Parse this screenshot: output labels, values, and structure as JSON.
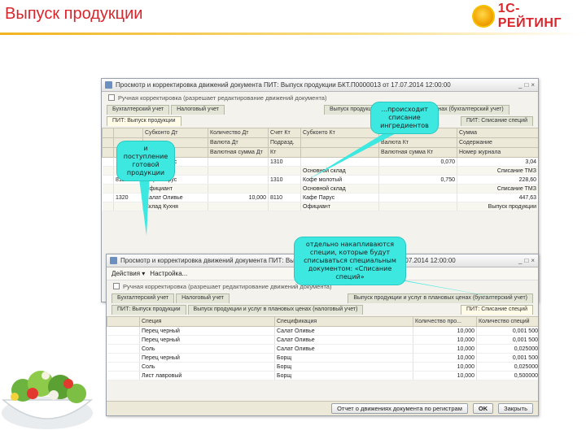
{
  "slide": {
    "title": "Выпуск продукции",
    "logo_text": "1С-РЕЙТИНГ"
  },
  "window1": {
    "title": "Просмотр и корректировка движений документа ПИТ: Выпуск продукции БКТ.П0000013 от 17.07.2014 12:00:00",
    "manual_check_label": "Ручная корректировка (разрешает редактирование движений документа)",
    "tabs": [
      "Бухгалтерский учет",
      "Налоговый учет",
      "ПИТ: Выпуск продукции",
      "Выпуск продукции и услуг в плановых ценах (бухгалтерский учет)",
      "ПИТ: Списание специй"
    ],
    "headers_row1": [
      "",
      "",
      "Субконто Дт",
      "Количество Дт",
      "Счет Кт",
      "Субконто Кт",
      "Количество Кт",
      "Сумма"
    ],
    "headers_row2": [
      "",
      "",
      "",
      "Валюта Дт",
      "Подразд.",
      "",
      "Валюта Кт",
      "Содержание"
    ],
    "headers_row3": [
      "",
      "",
      "",
      "Валютная сумма Дт",
      "Кт",
      "",
      "Валютная сумма Кт",
      "Номер журнала"
    ],
    "rows": [
      [
        "",
        "",
        "Кафе Парус",
        "",
        "1310",
        "",
        "0,070",
        "3,04"
      ],
      [
        "",
        "",
        "Официант",
        "",
        "",
        "Основной склад",
        "",
        "Списание ТМЗ"
      ],
      [
        "",
        "811",
        "Кафе Парус",
        "",
        "1310",
        "Кофе молотый",
        "0,750",
        "228,60"
      ],
      [
        "",
        "",
        "Официант",
        "",
        "",
        "Основной склад",
        "",
        "Списание ТМЗ"
      ],
      [
        "",
        "1320",
        "Салат Оливье",
        "10,000",
        "8110",
        "Кафе Парус",
        "",
        "447,63"
      ],
      [
        "",
        "",
        "Склад Кухня",
        "",
        "",
        "Официант",
        "",
        "Выпуск продукции"
      ]
    ]
  },
  "window2": {
    "title": "Просмотр и корректировка движений документа ПИТ: Выпуск продукции БКТ.П0000013 от 17.07.2014 12:00:00",
    "toolbar_actions": "Действия ▾",
    "toolbar_settings": "Настройка...",
    "manual_check_label": "Ручная корректировка (разрешает редактирование движений документа)",
    "tabs_row1": [
      "Бухгалтерский учет",
      "Налоговый учет",
      "Выпуск продукции и услуг в плановых ценах (бухгалтерский учет)"
    ],
    "tabs_row2": [
      "ПИТ: Выпуск продукции",
      "Выпуск продукции и услуг в плановых ценах (налоговый учет)",
      "ПИТ: Списание специй"
    ],
    "headers": [
      "Специя",
      "Спецификация",
      "Количество про...",
      "Количество специй"
    ],
    "rows": [
      [
        "Перец черный",
        "Салат Оливье",
        "10,000",
        "0,001 500"
      ],
      [
        "Перец черный",
        "Салат Оливье",
        "10,000",
        "0,001 500"
      ],
      [
        "Соль",
        "Салат Оливье",
        "10,000",
        "0,025000"
      ],
      [
        "Перец черный",
        "Борщ",
        "10,000",
        "0,001 500"
      ],
      [
        "Соль",
        "Борщ",
        "10,000",
        "0,025000"
      ],
      [
        "Лист лавровый",
        "Борщ",
        "10,000",
        "0,500000"
      ]
    ],
    "status_report": "Отчет о движениях документа по регистрам",
    "ok_label": "OK",
    "close_label": "Закрыть"
  },
  "callouts": {
    "writeoff": "…происходит списание ингредиентов",
    "receipt": "и поступление готовой продукции",
    "spices": "отдельно накапливаются специи, которые будут списываться специальным документом: «Списание специй»"
  },
  "colors": {
    "title_red": "#d8262c",
    "callout_cyan": "#3de8e0",
    "rule_gold": "#f1b420"
  }
}
